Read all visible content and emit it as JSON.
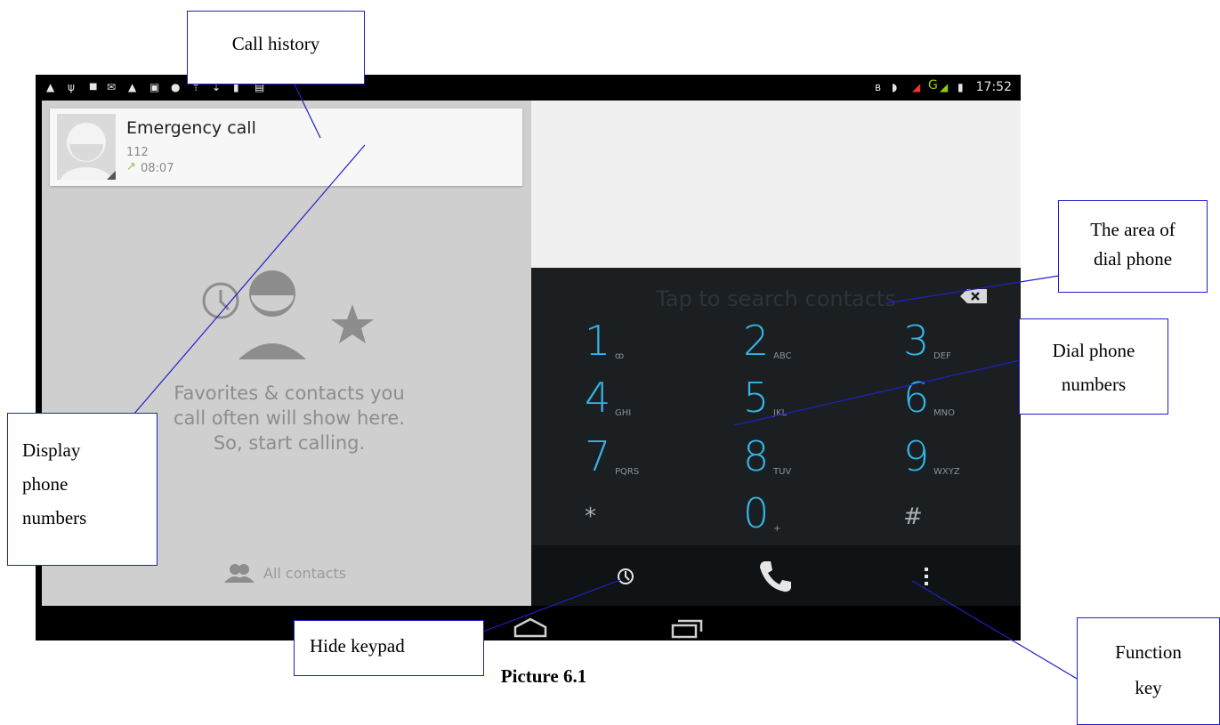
{
  "status_bar": {
    "notification_icons": [
      "warning-icon",
      "usb-icon",
      "lock-icon",
      "mail-icon",
      "warning-icon",
      "image-icon",
      "chrome-icon",
      "upload-icon",
      "download-icon",
      "sd-card-icon",
      "calendar-icon"
    ],
    "system_icons": [
      "bluetooth-icon",
      "wifi-icon",
      "signal-icon",
      "network-g-icon",
      "signal-icon",
      "battery-icon"
    ],
    "network_type": "G",
    "time": "17:52"
  },
  "recent_call": {
    "name": "Emergency call",
    "number": "112",
    "time": "08:07",
    "direction_icon": "outgoing-call-icon"
  },
  "favorites_empty": {
    "message_line1": "Favorites & contacts you",
    "message_line2": "call often will show here.",
    "message_line3": "So, start calling."
  },
  "all_contacts": {
    "label": "All contacts",
    "icon": "contacts-icon"
  },
  "dial_area": {
    "search_hint": "Tap to search contacts",
    "keys": [
      {
        "num": "1",
        "letters": "ꝏ"
      },
      {
        "num": "2",
        "letters": "ABC"
      },
      {
        "num": "3",
        "letters": "DEF"
      },
      {
        "num": "4",
        "letters": "GHI"
      },
      {
        "num": "5",
        "letters": "JKL"
      },
      {
        "num": "6",
        "letters": "MNO"
      },
      {
        "num": "7",
        "letters": "PQRS"
      },
      {
        "num": "8",
        "letters": "TUV"
      },
      {
        "num": "9",
        "letters": "WXYZ"
      },
      {
        "num": "*",
        "letters": ""
      },
      {
        "num": "0",
        "letters": "+"
      },
      {
        "num": "#",
        "letters": ""
      }
    ]
  },
  "action_bar": {
    "left_icon": "history-icon",
    "center_icon": "phone-call-icon",
    "right_icon": "overflow-menu-icon"
  },
  "nav_bar": {
    "icons": [
      "home-icon",
      "recent-apps-icon"
    ]
  },
  "callouts": {
    "call_history": "Call history",
    "dial_area_line1": "The area of",
    "dial_area_line2": "dial phone",
    "dial_numbers_line1": "Dial phone",
    "dial_numbers_line2": "numbers",
    "display_line1": "Display",
    "display_line2": "phone",
    "display_line3": "numbers",
    "hide_keypad": "Hide keypad",
    "function_line1": "Function",
    "function_line2": "key"
  },
  "caption": "Picture 6.1",
  "colors": {
    "accent": "#33b5e5",
    "callout_border": "#2020c8",
    "dialpad_bg": "#1b1f22"
  }
}
